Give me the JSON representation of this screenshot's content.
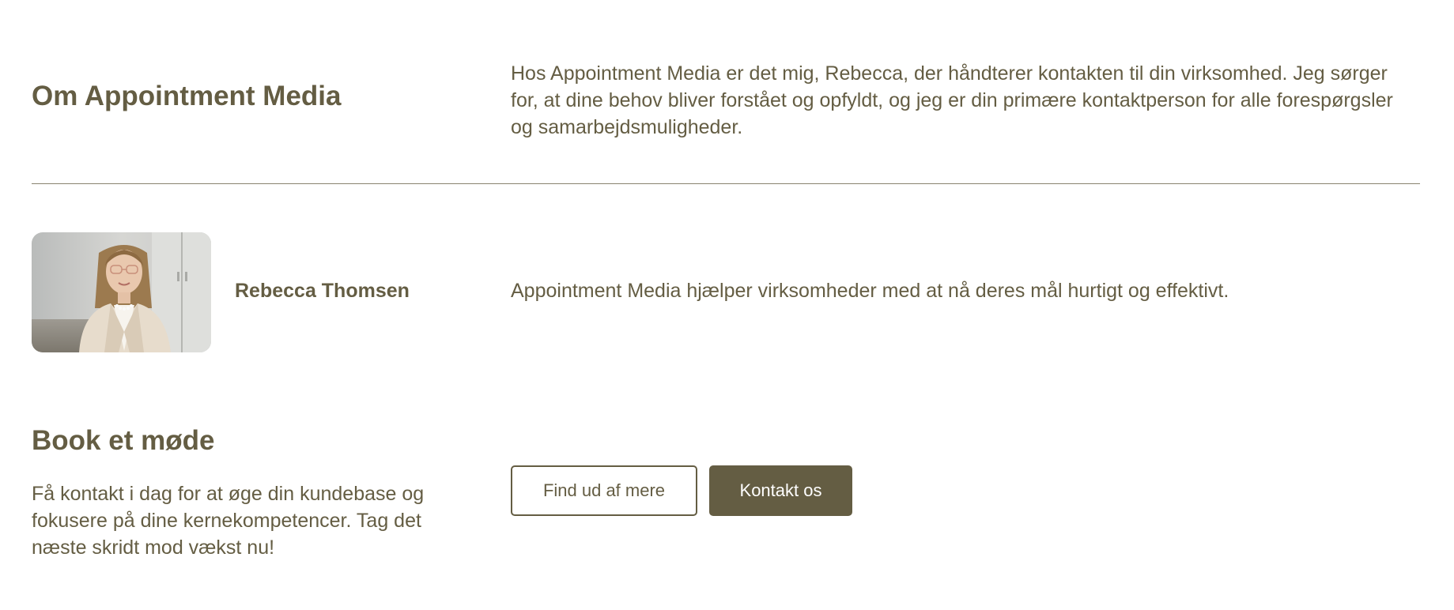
{
  "about": {
    "title": "Om Appointment Media",
    "text": "Hos Appointment Media er det mig, Rebecca, der håndterer kontakten til din virksomhed. Jeg sørger for, at dine behov bliver forstået og opfyldt, og jeg er din primære kontaktperson for alle forespørgsler og samarbejdsmuligheder."
  },
  "profile": {
    "name": "Rebecca Thomsen",
    "text": "Appointment Media hjælper virksomheder med at nå deres mål hurtigt og effektivt."
  },
  "booking": {
    "title": "Book et møde",
    "text": "Få kontakt i dag for at øge din kundebase og fokusere på dine kernekompetencer. Tag det næste skridt mod vækst nu!",
    "secondary_button": "Find ud af mere",
    "primary_button": "Kontakt os"
  },
  "colors": {
    "brand": "#645d43",
    "background": "#ffffff"
  }
}
